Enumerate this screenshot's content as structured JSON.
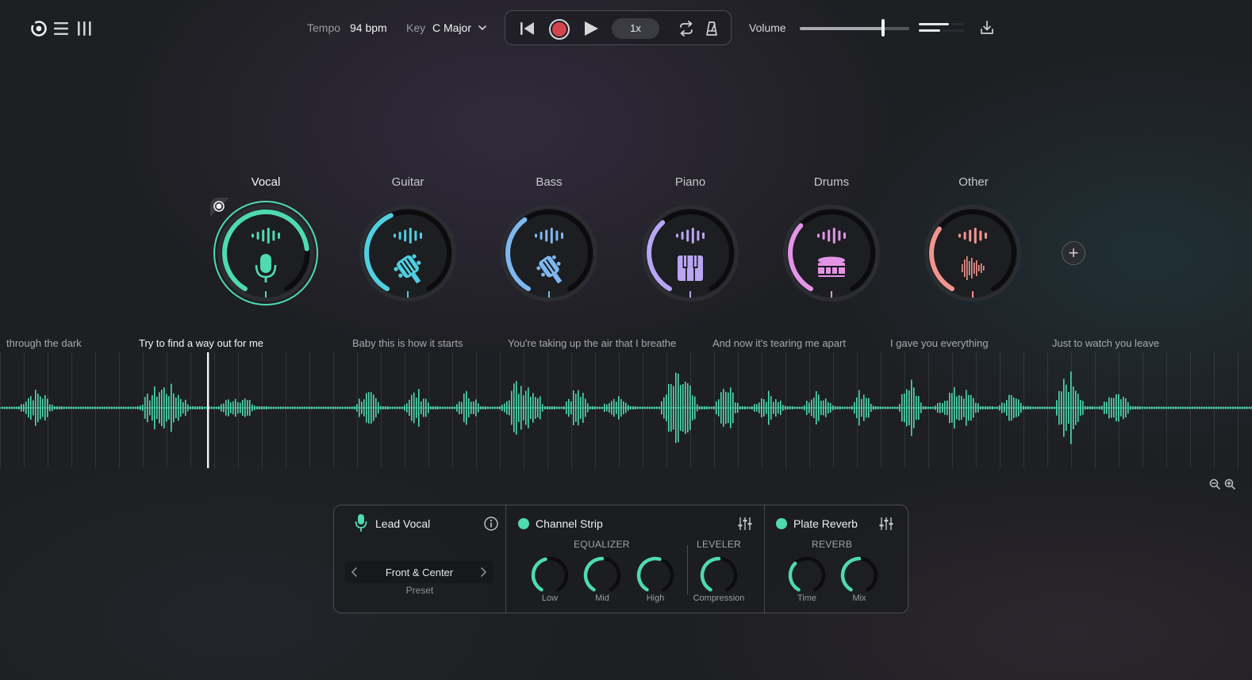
{
  "topbar": {
    "tempo_label": "Tempo",
    "tempo_value": "94 bpm",
    "key_label": "Key",
    "key_value": "C Major",
    "speed": "1x",
    "volume_label": "Volume",
    "volume_level": 0.76
  },
  "stems": [
    {
      "label": "Vocal",
      "color": "#4fdab0",
      "icon": "microphone-icon",
      "level": 0.78,
      "active": true
    },
    {
      "label": "Guitar",
      "color": "#4fcfe0",
      "icon": "guitar-icon",
      "level": 0.42,
      "active": false
    },
    {
      "label": "Bass",
      "color": "#7fb8ef",
      "icon": "bass-icon",
      "level": 0.38,
      "active": false
    },
    {
      "label": "Piano",
      "color": "#b9a6f3",
      "icon": "piano-icon",
      "level": 0.36,
      "active": false
    },
    {
      "label": "Drums",
      "color": "#e394e6",
      "icon": "drum-icon",
      "level": 0.34,
      "active": false
    },
    {
      "label": "Other",
      "color": "#f2958e",
      "icon": "waveform-icon",
      "level": 0.32,
      "active": false
    }
  ],
  "lyrics": [
    "through the dark",
    "Try to find a way out for me",
    "Baby this is how it starts",
    "You're taking up the air that I breathe",
    "And now it's tearing me apart",
    "I gave you everything",
    "Just to watch you leave"
  ],
  "playhead_fraction": 0.166,
  "waveform_color": "#4fdab0",
  "panel": {
    "track_name": "Lead Vocal",
    "preset_value": "Front & Center",
    "preset_caption": "Preset",
    "channel_strip": {
      "title": "Channel Strip",
      "equalizer_label": "EQUALIZER",
      "leveler_label": "LEVELER",
      "knobs": [
        {
          "label": "Low",
          "value": 0.45
        },
        {
          "label": "Mid",
          "value": 0.5
        },
        {
          "label": "High",
          "value": 0.55
        },
        {
          "label": "Compression",
          "value": 0.5
        }
      ]
    },
    "reverb": {
      "title": "Plate Reverb",
      "category_label": "REVERB",
      "knobs": [
        {
          "label": "Time",
          "value": 0.35
        },
        {
          "label": "Mix",
          "value": 0.5
        }
      ]
    }
  }
}
